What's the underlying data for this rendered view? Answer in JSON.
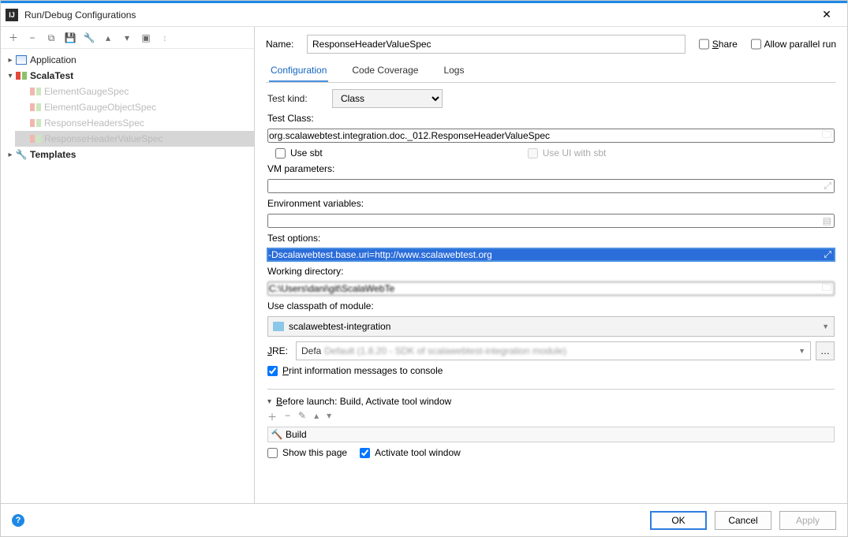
{
  "window": {
    "title": "Run/Debug Configurations"
  },
  "tree": {
    "application": "Application",
    "scalatest": "ScalaTest",
    "items": [
      "ElementGaugeSpec",
      "ElementGaugeObjectSpec",
      "ResponseHeadersSpec",
      "ResponseHeaderValueSpec"
    ],
    "templates": "Templates"
  },
  "name_label": "Name:",
  "name_value": "ResponseHeaderValueSpec",
  "share_label": "Share",
  "parallel_label": "Allow parallel run",
  "tabs": {
    "configuration": "Configuration",
    "coverage": "Code Coverage",
    "logs": "Logs"
  },
  "form": {
    "test_kind_label": "Test kind:",
    "test_kind_value": "Class",
    "test_class_label": "Test Class:",
    "test_class_value": "org.scalawebtest.integration.doc._012.ResponseHeaderValueSpec",
    "use_sbt": "Use sbt",
    "use_ui_sbt": "Use UI with sbt",
    "vm_label": "VM parameters:",
    "vm_value": "",
    "env_label": "Environment variables:",
    "env_value": "",
    "opts_label": "Test options:",
    "opts_value": "-Dscalawebtest.base.uri=http://www.scalawebtest.org",
    "wd_label": "Working directory:",
    "wd_value": "C:\\Users\\dani\\git\\ScalaWebTe",
    "module_label": "Use classpath of module:",
    "module_value": "scalawebtest-integration",
    "jre_label": "JRE:",
    "jre_value": "Default (1.8.20 - SDK of scalawebtest-integration module)",
    "print_info": "Print information messages to console"
  },
  "before_launch": {
    "heading": "Before launch: Build, Activate tool window",
    "build": "Build",
    "show_page": "Show this page",
    "activate": "Activate tool window"
  },
  "buttons": {
    "ok": "OK",
    "cancel": "Cancel",
    "apply": "Apply"
  }
}
